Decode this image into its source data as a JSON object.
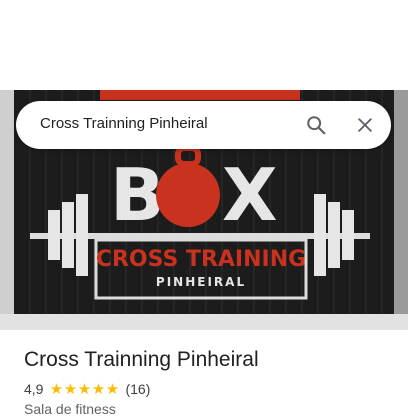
{
  "search": {
    "query": "Cross Trainning Pinheiral",
    "search_icon": "search-icon",
    "close_icon": "close-icon"
  },
  "photo": {
    "sign_line1": "BOX",
    "sign_line2": "CROSS TRAINING",
    "sign_line3": "PINHEIRAL"
  },
  "place": {
    "name": "Cross Trainning Pinheiral",
    "rating": "4,9",
    "stars": 5,
    "review_count": "(16)",
    "category": "Sala de fitness"
  },
  "colors": {
    "star": "#fbbc04",
    "sign_red": "#c8321e",
    "wall": "#1c1c1c"
  }
}
